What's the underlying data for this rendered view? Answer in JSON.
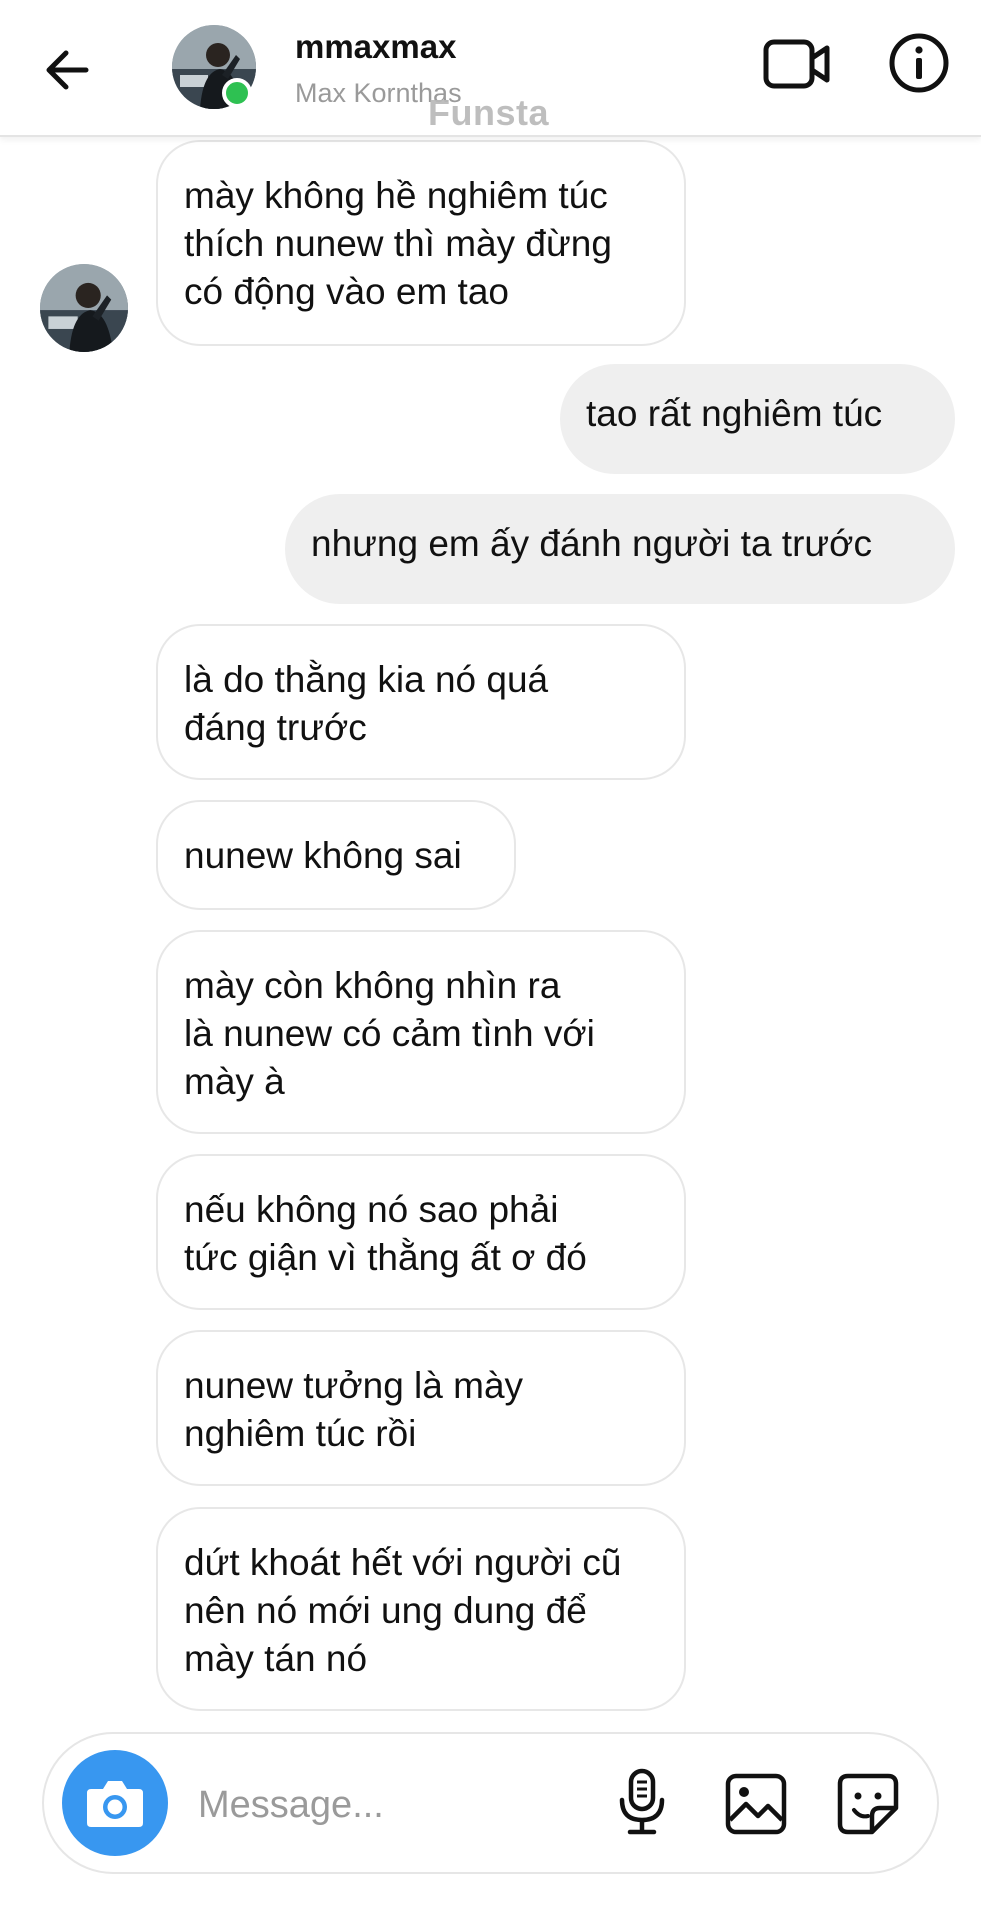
{
  "header": {
    "username": "mmaxmax",
    "full_name": "Max Kornthas",
    "watermark": "Funsta",
    "status": "online",
    "status_color": "#2ec152"
  },
  "icons": {
    "back": "arrow-left-icon",
    "video_call": "video-camera-icon",
    "info": "info-circle-icon",
    "camera": "camera-icon",
    "mic": "microphone-icon",
    "gallery": "image-icon",
    "sticker": "sticker-icon"
  },
  "messages": [
    {
      "side": "in",
      "text": "mày không hề nghiêm túc\nthích nunew thì mày đừng\ncó động vào em tao"
    },
    {
      "side": "out",
      "text": "tao rất nghiêm túc"
    },
    {
      "side": "out",
      "text": "nhưng em ấy đánh người ta trước"
    },
    {
      "side": "in",
      "text": "là do thằng kia nó quá\nđáng trước"
    },
    {
      "side": "in",
      "text": "nunew không sai"
    },
    {
      "side": "in",
      "text": "mày còn không nhìn ra\nlà nunew có cảm tình với\nmày à"
    },
    {
      "side": "in",
      "text": "nếu không nó sao phải\ntức giận vì thằng ất ơ đó"
    },
    {
      "side": "in",
      "text": "nunew tưởng là mày\nnghiêm túc rồi"
    },
    {
      "side": "in",
      "text": "dứt khoát hết với người cũ\nnên nó mới ung dung để\nmày tán nó"
    }
  ],
  "composer": {
    "placeholder": "Message...",
    "value": ""
  },
  "colors": {
    "accent": "#3897f0",
    "outgoing_bubble": "#efefef",
    "incoming_border": "#e7e7e7"
  }
}
